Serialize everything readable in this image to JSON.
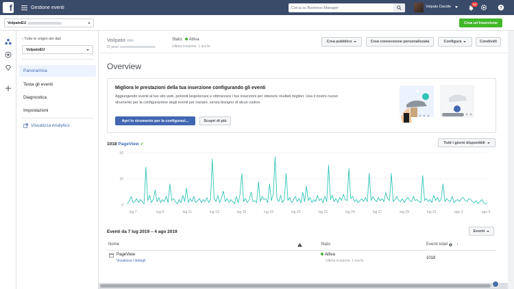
{
  "topbar": {
    "app_title": "Gestione eventi",
    "search_placeholder": "Cerca su Business Manager",
    "user_name": "Volpato Davide",
    "notifications_count": "58"
  },
  "subbar": {
    "account_name": "VolpatoEU",
    "create_ad_label": "Crea un'inserzione"
  },
  "sidenav": {
    "back_label": "Tutte le origini dei dati",
    "source_name": "VolpatoEU",
    "items": [
      {
        "label": "Panoramica"
      },
      {
        "label": "Testa gli eventi"
      },
      {
        "label": "Diagnostica"
      },
      {
        "label": "Impostazioni"
      }
    ],
    "analytics_label": "Visualizza Analytics"
  },
  "header": {
    "pixel_name": "Volpato",
    "id_label": "ID pixel:",
    "stato_label": "Stato:",
    "stato_value": "Attiva",
    "last_received": "Ultima ricezione: 1 ora fa",
    "buttons": {
      "crea_pubblico": "Crea pubblico",
      "crea_conversione": "Crea conversione personalizzata",
      "configura": "Configura",
      "condividi": "Condividi"
    }
  },
  "overview_title": "Overview",
  "promo": {
    "title": "Migliora le prestazioni della tua inserzione configurando gli eventi",
    "text": "Aggiungendo eventi al tuo sito web, potresti targetizzare e ottimizzare i tue inserzioni per ottenere risultati migliori. Usa il nostro nuovo strumento per la configurazione degli eventi per iniziare, senza bisogno di alcun codice.",
    "primary_btn": "Apri lo strumento per la configurazi...",
    "secondary_btn": "Scopri di più"
  },
  "chart_header": {
    "count": "1018",
    "event_name": "PageView",
    "range_btn": "Tutti i giorni disponibili"
  },
  "chart_data": {
    "type": "line",
    "ylim": [
      0,
      50
    ],
    "yticks": [
      "50",
      "25",
      "0"
    ],
    "xticks": [
      "lug 7",
      "lug 9",
      "lug 11",
      "lug 13",
      "lug 15",
      "lug 18",
      "lug 20",
      "lug 22",
      "lug 24",
      "lug 27",
      "lug 29",
      "lug 31",
      "ago 2",
      "ago 5"
    ],
    "color": "#2ec4b6",
    "values": [
      1,
      4,
      8,
      2,
      3,
      6,
      2,
      5,
      3,
      1,
      36,
      4,
      9,
      2,
      5,
      14,
      3,
      7,
      2,
      5,
      3,
      8,
      2,
      20,
      4,
      6,
      3,
      1,
      5,
      2,
      9,
      3,
      16,
      2,
      6,
      3,
      8,
      2,
      4,
      6,
      2,
      5,
      3,
      7,
      2,
      5,
      44,
      6,
      3,
      9,
      2,
      7,
      13,
      3,
      6,
      2,
      5,
      3,
      1,
      8,
      2,
      10,
      30,
      3,
      6,
      2,
      5,
      12,
      3,
      4,
      2,
      22,
      3,
      8,
      5,
      6,
      2,
      20,
      4,
      10,
      46,
      6,
      3,
      9,
      2,
      5,
      30,
      4,
      7,
      2,
      5,
      8,
      3,
      6,
      2,
      12,
      3,
      18,
      4,
      7,
      2,
      5,
      3,
      9,
      4,
      6,
      2,
      8,
      3,
      38,
      5,
      9,
      3,
      6,
      2,
      7,
      4,
      10,
      5,
      4,
      35,
      6,
      8,
      3,
      5,
      2,
      4,
      6,
      3,
      7,
      3,
      30,
      4,
      8,
      5,
      3,
      7,
      4,
      6,
      3,
      12,
      6,
      4,
      30,
      3,
      5,
      8,
      4,
      3,
      6,
      2,
      5,
      7,
      4,
      3,
      8,
      4,
      5,
      3,
      2,
      28,
      4,
      6,
      3,
      5,
      2,
      9,
      4,
      7,
      3,
      5,
      20,
      3,
      6,
      4,
      3,
      8,
      2,
      4,
      5,
      3,
      6,
      7,
      4,
      3,
      6,
      5,
      3,
      2,
      4,
      1,
      3,
      5,
      2,
      1,
      2
    ]
  },
  "events": {
    "title": "Eventi da 7 lug 2019 – 4 ago 2019",
    "eventi_btn": "Eventi",
    "columns": {
      "nome": "Nome",
      "stato": "Stato",
      "eventi_totali": "Eventi totali"
    },
    "rows": [
      {
        "name": "PageView",
        "details": "Visualizza i dettagli",
        "stato": "Attiva",
        "stato_sub": "Ultima ricezione: 1 ora fa",
        "total": "1018"
      }
    ]
  }
}
